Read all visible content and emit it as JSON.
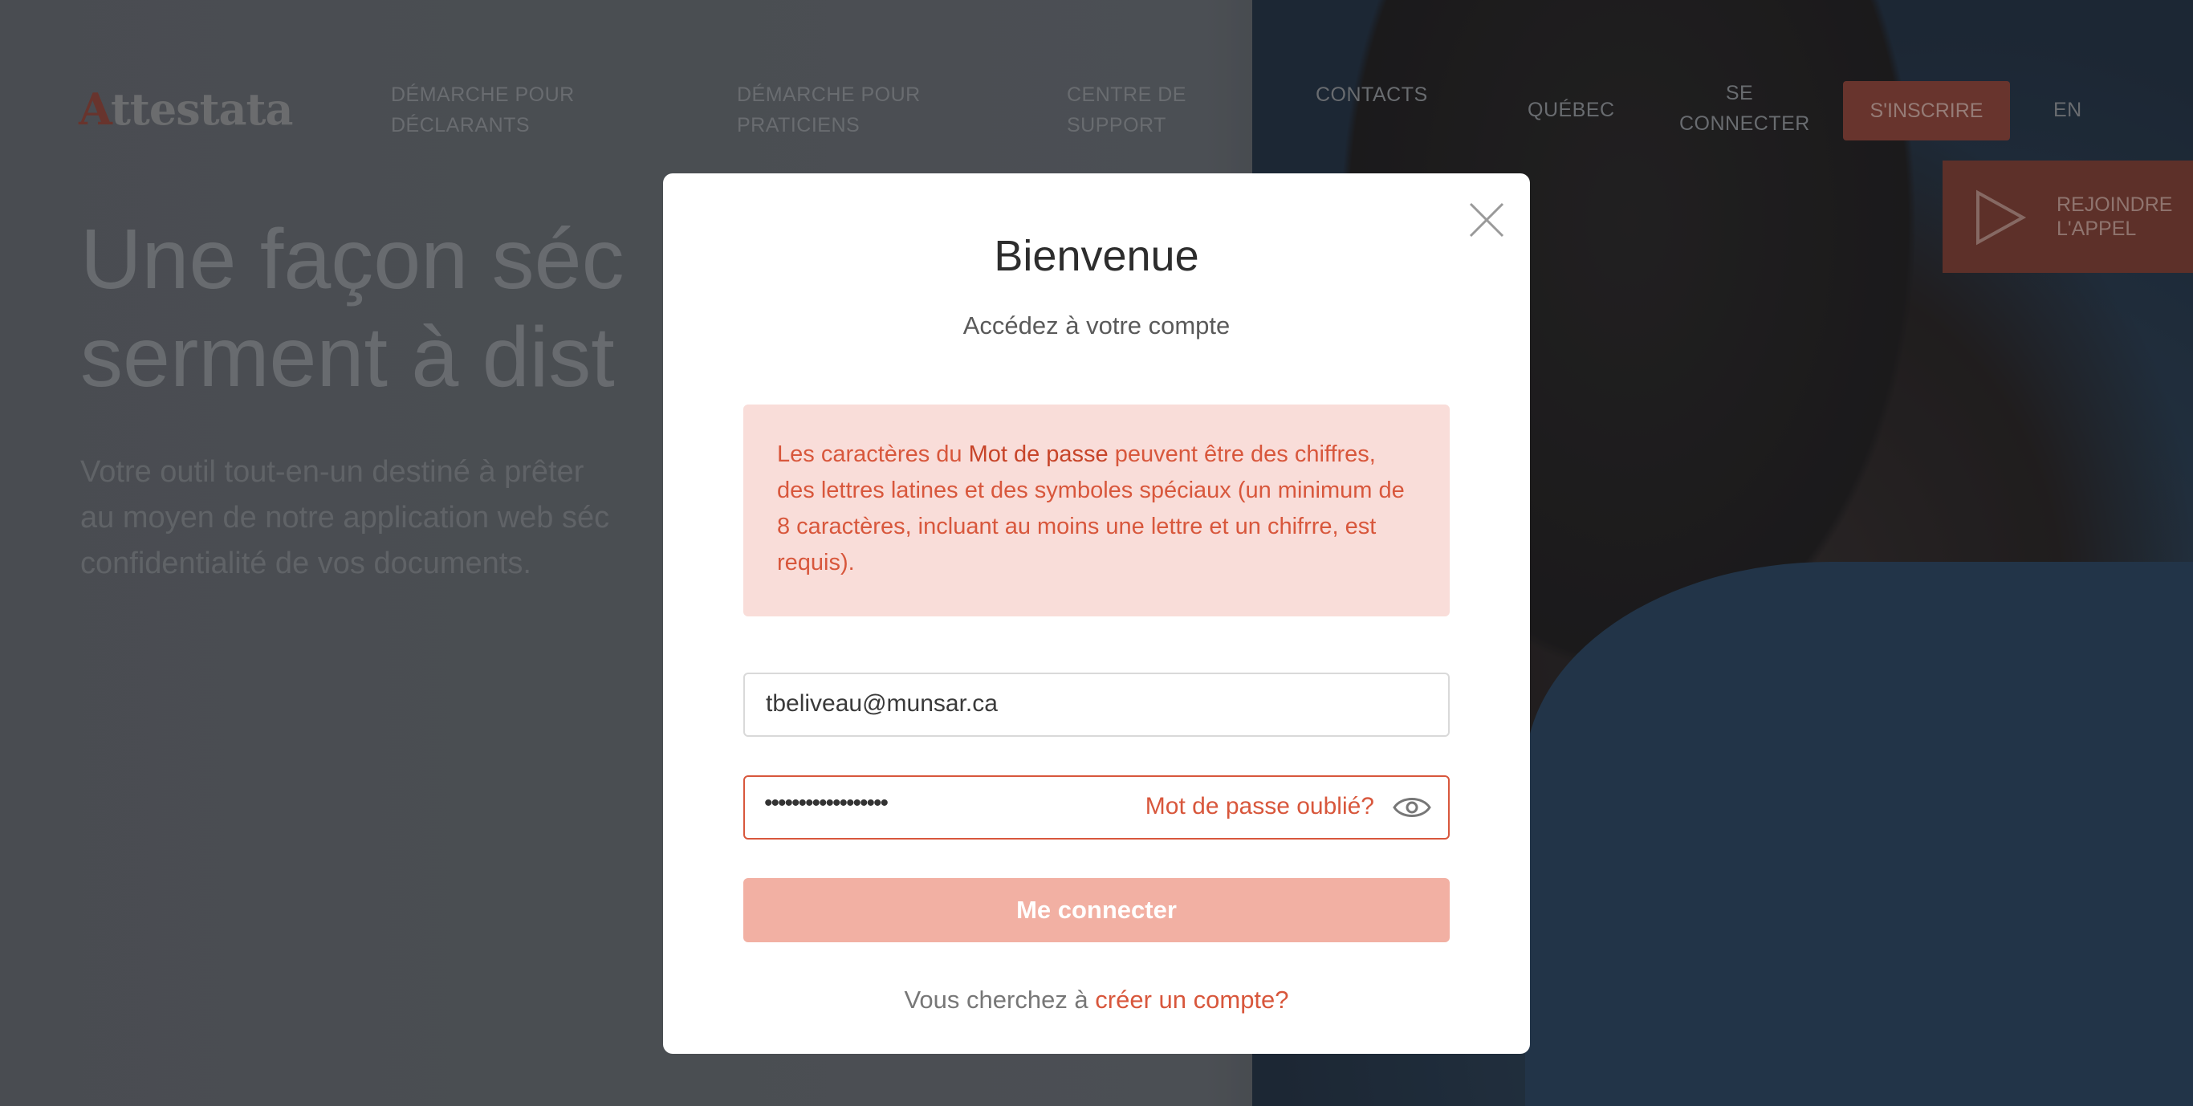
{
  "brand": {
    "logo_first_letter": "A",
    "logo_rest": "ttestata",
    "accent_color": "#d8573c"
  },
  "nav": {
    "items": [
      {
        "line1": "DÉMARCHE POUR",
        "line2": "DÉCLARANTS"
      },
      {
        "line1": "DÉMARCHE POUR",
        "line2": "PRATICIENS"
      },
      {
        "line1": "CENTRE DE",
        "line2": "SUPPORT"
      },
      {
        "line1": "CONTACTS",
        "line2": ""
      },
      {
        "line1": "QUÉBEC",
        "line2": ""
      },
      {
        "line1": "SE",
        "line2": "CONNECTER"
      }
    ],
    "signup_label": "S'INSCRIRE",
    "language": "EN"
  },
  "join_call": {
    "line1": "REJOINDRE",
    "line2": "L'APPEL",
    "icon": "play-icon"
  },
  "hero": {
    "title": "Une façon séc\nserment à dist",
    "text": "Votre outil tout-en-un destiné à prêter\nau moyen de notre application web séc\nconfidentialité de vos documents."
  },
  "modal": {
    "title": "Bienvenue",
    "subtitle": "Accédez à votre compte",
    "close_icon": "close-icon",
    "alert": {
      "before": "Les caractères du ",
      "strong": "Mot de passe",
      "after": " peuvent être des chiffres, des lettres latines et des symboles spéciaux (un minimum de 8 caractères, incluant au moins une lettre et un chifrre, est requis)."
    },
    "email_value": "tbeliveau@munsar.ca",
    "password_masked": "••••••••••••••••••",
    "forgot_label": "Mot de passe oublié?",
    "eye_icon": "eye-icon",
    "submit_label": "Me connecter",
    "footer_text": "Vous cherchez à ",
    "footer_link": "créer un compte?"
  }
}
